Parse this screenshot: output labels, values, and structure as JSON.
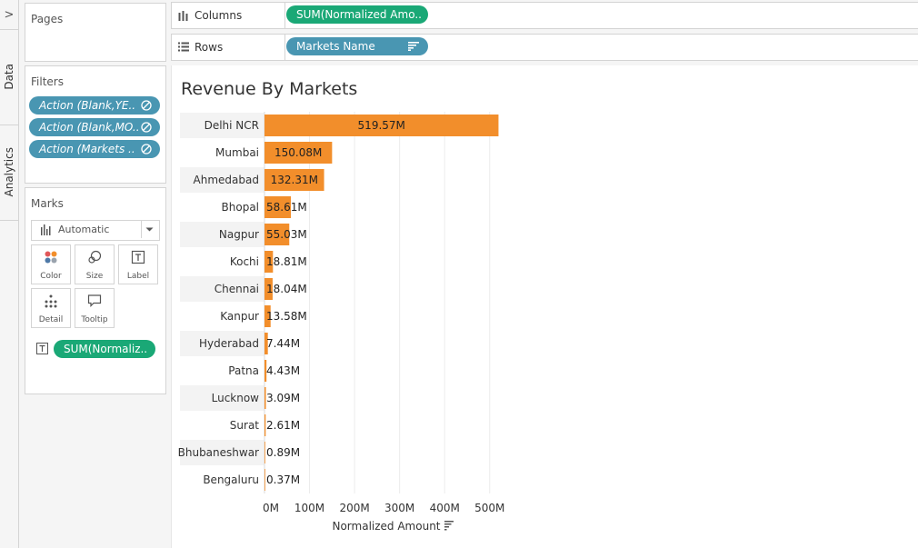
{
  "side_tabs": {
    "collapse_arrow": ">",
    "data": "Data",
    "analytics": "Analytics"
  },
  "pages": {
    "title": "Pages"
  },
  "filters": {
    "title": "Filters",
    "items": [
      "Action (Blank,YE..",
      "Action (Blank,MO..",
      "Action (Markets .."
    ]
  },
  "marks": {
    "title": "Marks",
    "type_selected": "Automatic",
    "buttons": [
      "Color",
      "Size",
      "Label",
      "Detail",
      "Tooltip"
    ],
    "field_pill": "SUM(Normaliz.."
  },
  "shelves": {
    "columns_label": "Columns",
    "columns_pill": "SUM(Normalized Amo..",
    "rows_label": "Rows",
    "rows_pill": "Markets Name"
  },
  "colors": {
    "bar": "#f28e2b",
    "filter_pill": "#4996b2",
    "measure_pill": "#1aa876",
    "band": "#f3f3f3"
  },
  "chart_data": {
    "type": "bar",
    "orientation": "horizontal",
    "title": "Revenue By Markets",
    "categories": [
      "Delhi NCR",
      "Mumbai",
      "Ahmedabad",
      "Bhopal",
      "Nagpur",
      "Kochi",
      "Chennai",
      "Kanpur",
      "Hyderabad",
      "Patna",
      "Lucknow",
      "Surat",
      "Bhubaneshwar",
      "Bengaluru"
    ],
    "values": [
      519.57,
      150.08,
      132.31,
      58.61,
      55.03,
      18.81,
      18.04,
      13.58,
      7.44,
      4.43,
      3.09,
      2.61,
      0.89,
      0.37
    ],
    "labels": [
      "519.57M",
      "150.08M",
      "132.31M",
      "58.61M",
      "55.03M",
      "18.81M",
      "18.04M",
      "13.58M",
      "7.44M",
      "4.43M",
      "3.09M",
      "2.61M",
      "0.89M",
      "0.37M"
    ],
    "xlabel": "Normalized Amount",
    "xticks": [
      "0M",
      "100M",
      "200M",
      "300M",
      "400M",
      "500M"
    ],
    "xlim": [
      0,
      500
    ],
    "grid": "vertical"
  }
}
